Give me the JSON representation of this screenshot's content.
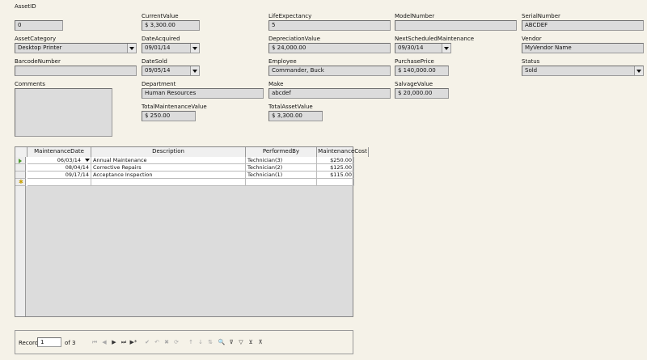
{
  "form": {
    "asset_id": {
      "label": "AssetID",
      "value": "0"
    },
    "current_value": {
      "label": "CurrentValue",
      "value": "$ 3,300.00"
    },
    "life_expectancy": {
      "label": "LifeExpectancy",
      "value": "5"
    },
    "model_number": {
      "label": "ModelNumber",
      "value": ""
    },
    "serial_number": {
      "label": "SerialNumber",
      "value": "ABCDEF"
    },
    "asset_category": {
      "label": "AssetCategory",
      "value": "Desktop Printer"
    },
    "date_acquired": {
      "label": "DateAcquired",
      "value": "09/01/14"
    },
    "depreciation_value": {
      "label": "DepreciationValue",
      "value": "$ 24,000.00"
    },
    "next_scheduled_maintenance": {
      "label": "NextScheduledMaintenance",
      "value": "09/30/14"
    },
    "vendor": {
      "label": "Vendor",
      "value": "MyVendor Name"
    },
    "barcode_number": {
      "label": "BarcodeNumber",
      "value": ""
    },
    "date_sold": {
      "label": "DateSold",
      "value": "09/05/14"
    },
    "employee": {
      "label": "Employee",
      "value": "Commander, Buck"
    },
    "purchase_price": {
      "label": "PurchasePrice",
      "value": "$ 140,000.00"
    },
    "status": {
      "label": "Status",
      "value": "Sold"
    },
    "comments": {
      "label": "Comments",
      "value": ""
    },
    "department": {
      "label": "Department",
      "value": "Human Resources"
    },
    "make": {
      "label": "Make",
      "value": "abcdef"
    },
    "salvage_value": {
      "label": "SalvageValue",
      "value": "$ 20,000.00"
    },
    "total_maintenance_value": {
      "label": "TotalMaintenanceValue",
      "value": "$ 250.00"
    },
    "total_asset_value": {
      "label": "TotalAssetValue",
      "value": "$ 3,300.00"
    }
  },
  "grid": {
    "columns": [
      "MaintenanceDate",
      "Description",
      "PerformedBy",
      "MaintenanceCost"
    ],
    "rows": [
      [
        "06/03/14",
        "Annual Maintenance",
        "Technician(3)",
        "$250.00"
      ],
      [
        "08/04/14",
        "Corrective Repairs",
        "Technician(2)",
        "$125.00"
      ],
      [
        "09/17/14",
        "Acceptance Inspection",
        "Technician(1)",
        "$115.00"
      ]
    ],
    "new_row_marker": "✱"
  },
  "navigator": {
    "record_label": "Record",
    "record_value": "1",
    "of_label": "of",
    "total": "3",
    "buttons": {
      "first": "⏮",
      "prev": "◀",
      "next": "▶",
      "last": "⏭",
      "new": "▶*",
      "save": "✔",
      "undo": "↶",
      "delete": "✖",
      "refresh": "⟳",
      "sort_asc": "↑",
      "sort_desc": "↓",
      "sort": "⇅",
      "find": "🔍",
      "autofilter": "⊽",
      "filter": "▽",
      "apply_filter": "⊻",
      "reset_filter": "⊼"
    }
  }
}
